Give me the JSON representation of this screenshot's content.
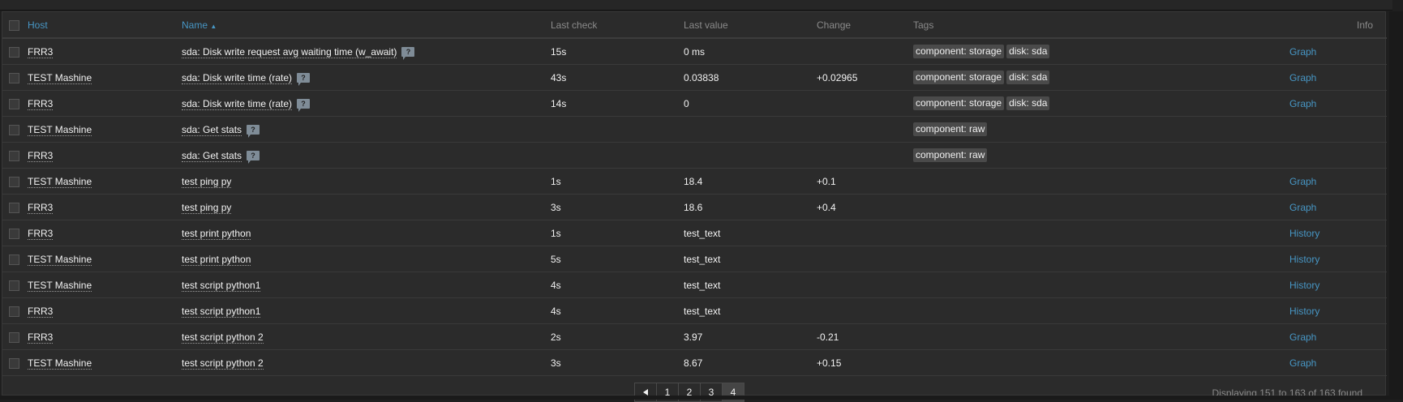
{
  "columns": {
    "host": "Host",
    "name": "Name",
    "name_sort_icon": "sort-ascending-icon",
    "last_check": "Last check",
    "last_value": "Last value",
    "change": "Change",
    "tags": "Tags",
    "info": "Info"
  },
  "rows": [
    {
      "host": "FRR3",
      "name": "sda: Disk write request avg waiting time (w_await)",
      "hint": "?",
      "last_check": "15s",
      "last_value": "0 ms",
      "change": "",
      "tags": [
        "component: storage",
        "disk: sda"
      ],
      "action": "Graph"
    },
    {
      "host": "TEST Mashine",
      "name": "sda: Disk write time (rate)",
      "hint": "?",
      "last_check": "43s",
      "last_value": "0.03838",
      "change": "+0.02965",
      "tags": [
        "component: storage",
        "disk: sda"
      ],
      "action": "Graph"
    },
    {
      "host": "FRR3",
      "name": "sda: Disk write time (rate)",
      "hint": "?",
      "last_check": "14s",
      "last_value": "0",
      "change": "",
      "tags": [
        "component: storage",
        "disk: sda"
      ],
      "action": "Graph"
    },
    {
      "host": "TEST Mashine",
      "name": "sda: Get stats",
      "hint": "?",
      "last_check": "",
      "last_value": "",
      "change": "",
      "tags": [
        "component: raw"
      ],
      "action": ""
    },
    {
      "host": "FRR3",
      "name": "sda: Get stats",
      "hint": "?",
      "last_check": "",
      "last_value": "",
      "change": "",
      "tags": [
        "component: raw"
      ],
      "action": ""
    },
    {
      "host": "TEST Mashine",
      "name": "test ping py",
      "hint": "",
      "last_check": "1s",
      "last_value": "18.4",
      "change": "+0.1",
      "tags": [],
      "action": "Graph"
    },
    {
      "host": "FRR3",
      "name": "test ping py",
      "hint": "",
      "last_check": "3s",
      "last_value": "18.6",
      "change": "+0.4",
      "tags": [],
      "action": "Graph"
    },
    {
      "host": "FRR3",
      "name": "test print python",
      "hint": "",
      "last_check": "1s",
      "last_value": "test_text",
      "change": "",
      "tags": [],
      "action": "History"
    },
    {
      "host": "TEST Mashine",
      "name": "test print python",
      "hint": "",
      "last_check": "5s",
      "last_value": "test_text",
      "change": "",
      "tags": [],
      "action": "History"
    },
    {
      "host": "TEST Mashine",
      "name": "test script python1",
      "hint": "",
      "last_check": "4s",
      "last_value": "test_text",
      "change": "",
      "tags": [],
      "action": "History"
    },
    {
      "host": "FRR3",
      "name": "test script python1",
      "hint": "",
      "last_check": "4s",
      "last_value": "test_text",
      "change": "",
      "tags": [],
      "action": "History"
    },
    {
      "host": "FRR3",
      "name": "test script python 2",
      "hint": "",
      "last_check": "2s",
      "last_value": "3.97",
      "change": "-0.21",
      "tags": [],
      "action": "Graph"
    },
    {
      "host": "TEST Mashine",
      "name": "test script python 2",
      "hint": "",
      "last_check": "3s",
      "last_value": "8.67",
      "change": "+0.15",
      "tags": [],
      "action": "Graph"
    }
  ],
  "pagination": {
    "prev_icon": "arrow-left-icon",
    "pages": [
      "1",
      "2",
      "3",
      "4"
    ],
    "current": "4"
  },
  "summary": "Displaying 151 to 163 of 163 found",
  "colors": {
    "link_accent": "#4796c4",
    "background": "#2b2b2b",
    "tag_bg": "#4a4a4a"
  }
}
